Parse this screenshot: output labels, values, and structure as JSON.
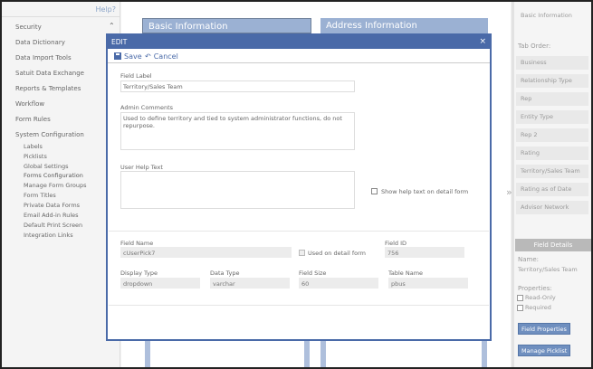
{
  "help_link": "Help?",
  "nav": {
    "items": [
      {
        "label": "Security"
      },
      {
        "label": "Data Dictionary"
      },
      {
        "label": "Data Import Tools"
      },
      {
        "label": "Satuit Data Exchange"
      },
      {
        "label": "Reports & Templates"
      },
      {
        "label": "Workflow"
      },
      {
        "label": "Form Rules"
      },
      {
        "label": "System Configuration"
      }
    ],
    "sub_items": [
      {
        "label": "Labels"
      },
      {
        "label": "Picklists"
      },
      {
        "label": "Global Settings"
      },
      {
        "label": "Forms Configuration"
      },
      {
        "label": "Manage Form Groups"
      },
      {
        "label": "Form Titles"
      },
      {
        "label": "Private Data Forms"
      },
      {
        "label": "Email Add-in Rules"
      },
      {
        "label": "Default Print Screen"
      },
      {
        "label": "Integration Links"
      }
    ]
  },
  "sections": {
    "basic": "Basic Information",
    "address": "Address Information"
  },
  "right_panel": {
    "top_item": "Basic Information",
    "tab_order_label": "Tab Order:",
    "tab_items": [
      "Business",
      "Relationship Type",
      "Rep",
      "Entity Type",
      "Rep 2",
      "Rating",
      "Territory/Sales Team",
      "Rating as of Date",
      "Advisor Network"
    ],
    "field_details_title": "Field Details",
    "name_label": "Name:",
    "name_value": "Territory/Sales Team",
    "properties_label": "Properties:",
    "read_only_label": "Read-Only",
    "required_label": "Required",
    "field_properties_btn": "Field Properties",
    "manage_picklist_btn": "Manage Picklist"
  },
  "modal": {
    "title": "EDIT",
    "close": "×",
    "save": "Save",
    "cancel": "Cancel",
    "field_label_label": "Field Label",
    "field_label_value": "Territory/Sales Team",
    "admin_comments_label": "Admin Comments",
    "admin_comments_value": "Used to define territory and tied to system administrator functions, do not repurpose.",
    "user_help_label": "User Help Text",
    "user_help_value": "",
    "show_help_label": "Show help text on detail form",
    "field_name_label": "Field Name",
    "field_name_value": "cUserPick7",
    "used_on_detail_label": "Used on detail form",
    "field_id_label": "Field ID",
    "field_id_value": "756",
    "display_type_label": "Display Type",
    "display_type_value": "dropdown",
    "data_type_label": "Data Type",
    "data_type_value": "varchar",
    "field_size_label": "Field Size",
    "field_size_value": "60",
    "table_name_label": "Table Name",
    "table_name_value": "pbus"
  },
  "colors": {
    "modal_header": "#4a6aa8",
    "section_header": "#9bb1d3",
    "button": "#6f8fbf"
  }
}
